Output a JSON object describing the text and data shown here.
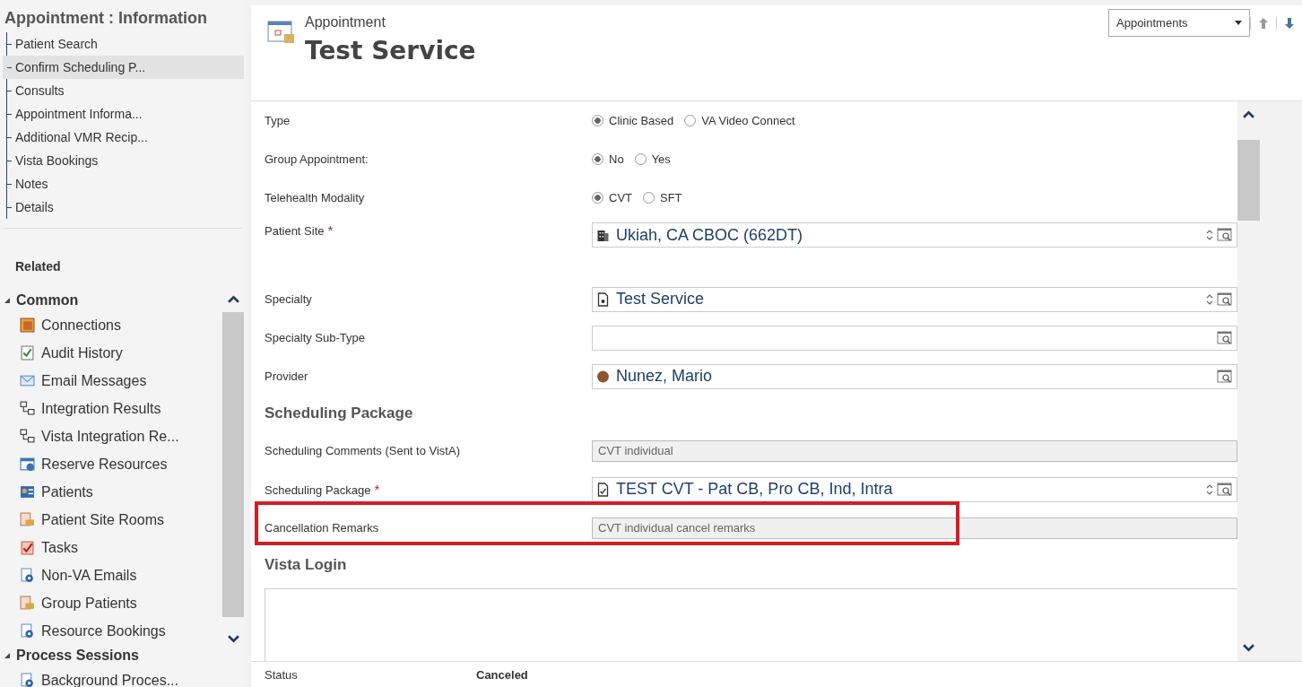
{
  "sidebar": {
    "title": "Appointment : Information",
    "nav_items": [
      {
        "label": "Patient Search",
        "selected": false
      },
      {
        "label": "Confirm Scheduling P...",
        "selected": true
      },
      {
        "label": "Consults",
        "selected": false
      },
      {
        "label": "Appointment Informa...",
        "selected": false
      },
      {
        "label": "Additional VMR Recip...",
        "selected": false
      },
      {
        "label": "Vista Bookings",
        "selected": false
      },
      {
        "label": "Notes",
        "selected": false
      },
      {
        "label": "Details",
        "selected": false
      }
    ],
    "related_heading": "Related",
    "groups": [
      {
        "label": "Common",
        "expanded": true,
        "items": [
          "Connections",
          "Audit History",
          "Email Messages",
          "Integration Results",
          "Vista Integration Re...",
          "Reserve Resources",
          "Patients",
          "Patient Site Rooms",
          "Tasks",
          "Non-VA Emails",
          "Group Patients",
          "Resource Bookings"
        ]
      },
      {
        "label": "Process Sessions",
        "expanded": true,
        "items": [
          "Background Proces..."
        ]
      }
    ]
  },
  "header": {
    "entity": "Appointment",
    "title": "Test Service",
    "view_select": "Appointments"
  },
  "sections": [
    {
      "fields": [
        {
          "kind": "radio",
          "label": "Type",
          "options": [
            {
              "label": "Clinic Based",
              "selected": true
            },
            {
              "label": "VA Video Connect",
              "selected": false
            }
          ]
        },
        {
          "kind": "radio",
          "label": "Group Appointment:",
          "options": [
            {
              "label": "No",
              "selected": true
            },
            {
              "label": "Yes",
              "selected": false
            }
          ]
        },
        {
          "kind": "radio",
          "label": "Telehealth Modality",
          "options": [
            {
              "label": "CVT",
              "selected": true
            },
            {
              "label": "SFT",
              "selected": false
            }
          ]
        },
        {
          "kind": "lookup",
          "label": "Patient Site",
          "required_mark": "*",
          "value": "Ukiah, CA CBOC (662DT)"
        },
        {
          "kind": "lookup",
          "label": "Specialty",
          "value": "Test Service"
        },
        {
          "kind": "lookup",
          "label": "Specialty Sub-Type"
        },
        {
          "kind": "lookup",
          "label": "Provider",
          "value": "Nunez, Mario"
        }
      ]
    },
    {
      "heading": "Scheduling Package",
      "fields": [
        {
          "kind": "text",
          "label": "Scheduling Comments (Sent to VistA)",
          "value": "CVT individual"
        },
        {
          "kind": "lookup",
          "label": "Scheduling Package",
          "required_mark": "*",
          "value": "TEST CVT - Pat CB, Pro CB, Ind, Intra"
        },
        {
          "kind": "text",
          "label": "Cancellation Remarks",
          "value": "CVT individual cancel remarks",
          "highlighted": true
        }
      ]
    },
    {
      "heading": "Vista Login",
      "fields": [
        {
          "kind": "box"
        }
      ]
    }
  ],
  "status_bar": {
    "label": "Status",
    "value": "Canceled"
  }
}
